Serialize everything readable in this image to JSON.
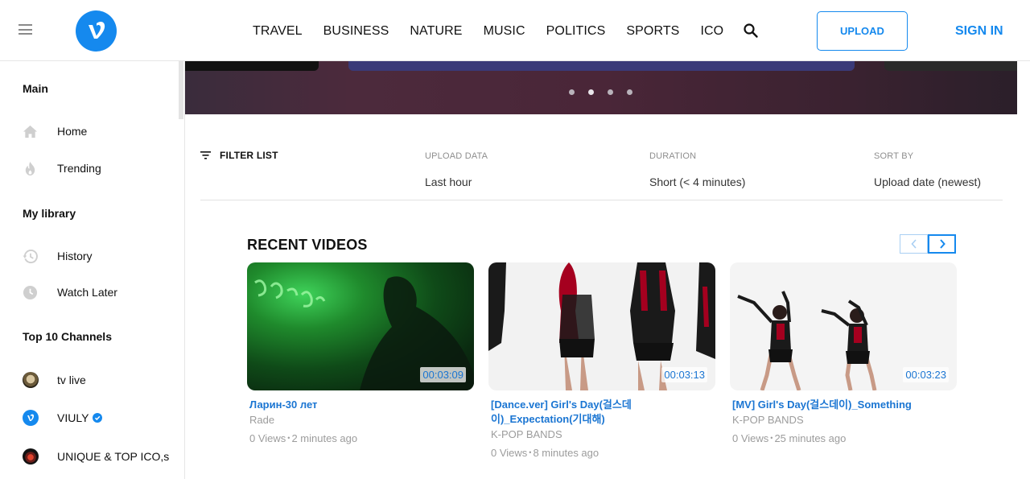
{
  "header": {
    "nav": [
      "TRAVEL",
      "BUSINESS",
      "NATURE",
      "MUSIC",
      "POLITICS",
      "SPORTS",
      "ICO"
    ],
    "upload_label": "UPLOAD",
    "signin_label": "SIGN IN",
    "icons": {
      "menu": "hamburger-menu-icon",
      "logo": "viuly-logo",
      "search": "search-icon"
    }
  },
  "colors": {
    "accent": "#1589ee",
    "link": "#1a75d2",
    "muted": "#9c9c9c"
  },
  "sidebar": {
    "main_heading": "Main",
    "main_items": [
      {
        "label": "Home",
        "icon": "home-icon"
      },
      {
        "label": "Trending",
        "icon": "flame-icon"
      }
    ],
    "library_heading": "My library",
    "library_items": [
      {
        "label": "History",
        "icon": "history-icon"
      },
      {
        "label": "Watch Later",
        "icon": "clock-icon"
      }
    ],
    "channels_heading": "Top 10 Channels",
    "channels": [
      {
        "label": "tv live"
      },
      {
        "label": "VIULY",
        "verified": true
      },
      {
        "label": "UNIQUE & TOP ICO,s"
      }
    ]
  },
  "banner": {
    "slide_count": 4,
    "active_slide": 2
  },
  "filter": {
    "label": "FILTER LIST",
    "columns": [
      {
        "heading": "UPLOAD DATA",
        "value": "Last hour"
      },
      {
        "heading": "DURATION",
        "value": "Short (< 4 minutes)"
      },
      {
        "heading": "SORT BY",
        "value": "Upload date (newest)"
      }
    ]
  },
  "recent": {
    "title": "RECENT VIDEOS",
    "videos": [
      {
        "title": "Ларин-30 лет",
        "channel": "Rade",
        "views": "0 Views",
        "time": "2 minutes ago",
        "duration": "00:03:09"
      },
      {
        "title": "[Dance.ver] Girl's Day(걸스데이)_Expectation(기대해)",
        "channel": "K-POP BANDS",
        "views": "0 Views",
        "time": "8 minutes ago",
        "duration": "00:03:13"
      },
      {
        "title": "[MV] Girl's Day(걸스데이)_Something",
        "channel": "K-POP BANDS",
        "views": "0 Views",
        "time": "25 minutes ago",
        "duration": "00:03:23"
      }
    ]
  }
}
